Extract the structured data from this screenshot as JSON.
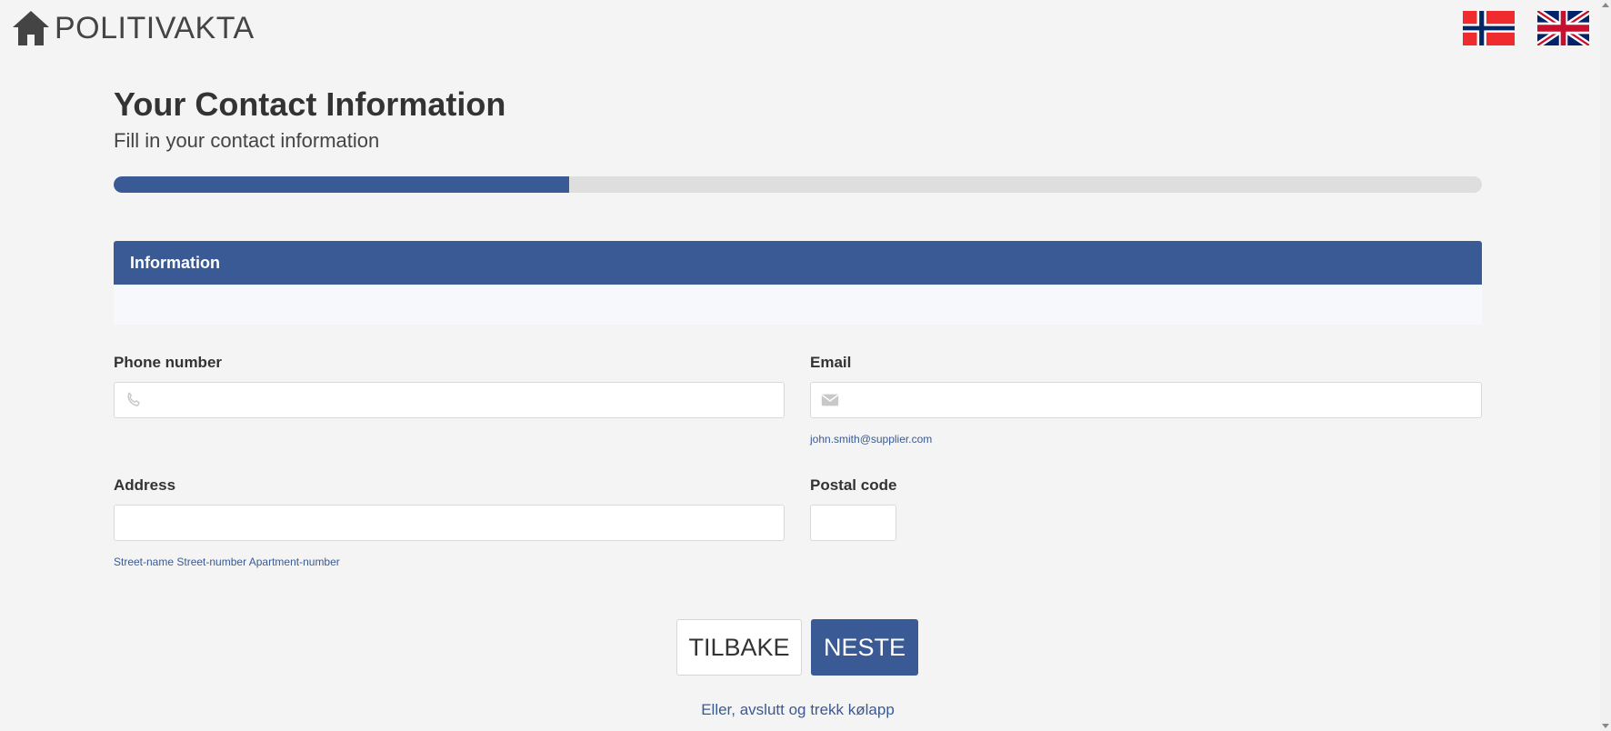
{
  "header": {
    "brand": "POLITIVAKTA",
    "icons": {
      "home": "home-icon",
      "flag_no": "norway-flag-icon",
      "flag_gb": "uk-flag-icon"
    }
  },
  "page": {
    "title": "Your Contact Information",
    "subtitle": "Fill in your contact information",
    "progress_fraction": 0.333
  },
  "info_panel": {
    "title": "Information",
    "body": ""
  },
  "form": {
    "phone": {
      "label": "Phone number",
      "value": "",
      "icon": "phone-icon"
    },
    "email": {
      "label": "Email",
      "value": "",
      "icon": "envelope-icon",
      "help": "john.smith@supplier.com"
    },
    "address": {
      "label": "Address",
      "value": "",
      "help": "Street-name Street-number Apartment-number"
    },
    "postal_code": {
      "label": "Postal code",
      "value": ""
    }
  },
  "actions": {
    "back_label": "TILBAKE",
    "next_label": "NESTE",
    "exit_label": "Eller, avslutt og trekk kølapp"
  },
  "colors": {
    "accent": "#3a5a95",
    "background": "#f4f4f4",
    "progress_track": "#dedede"
  }
}
